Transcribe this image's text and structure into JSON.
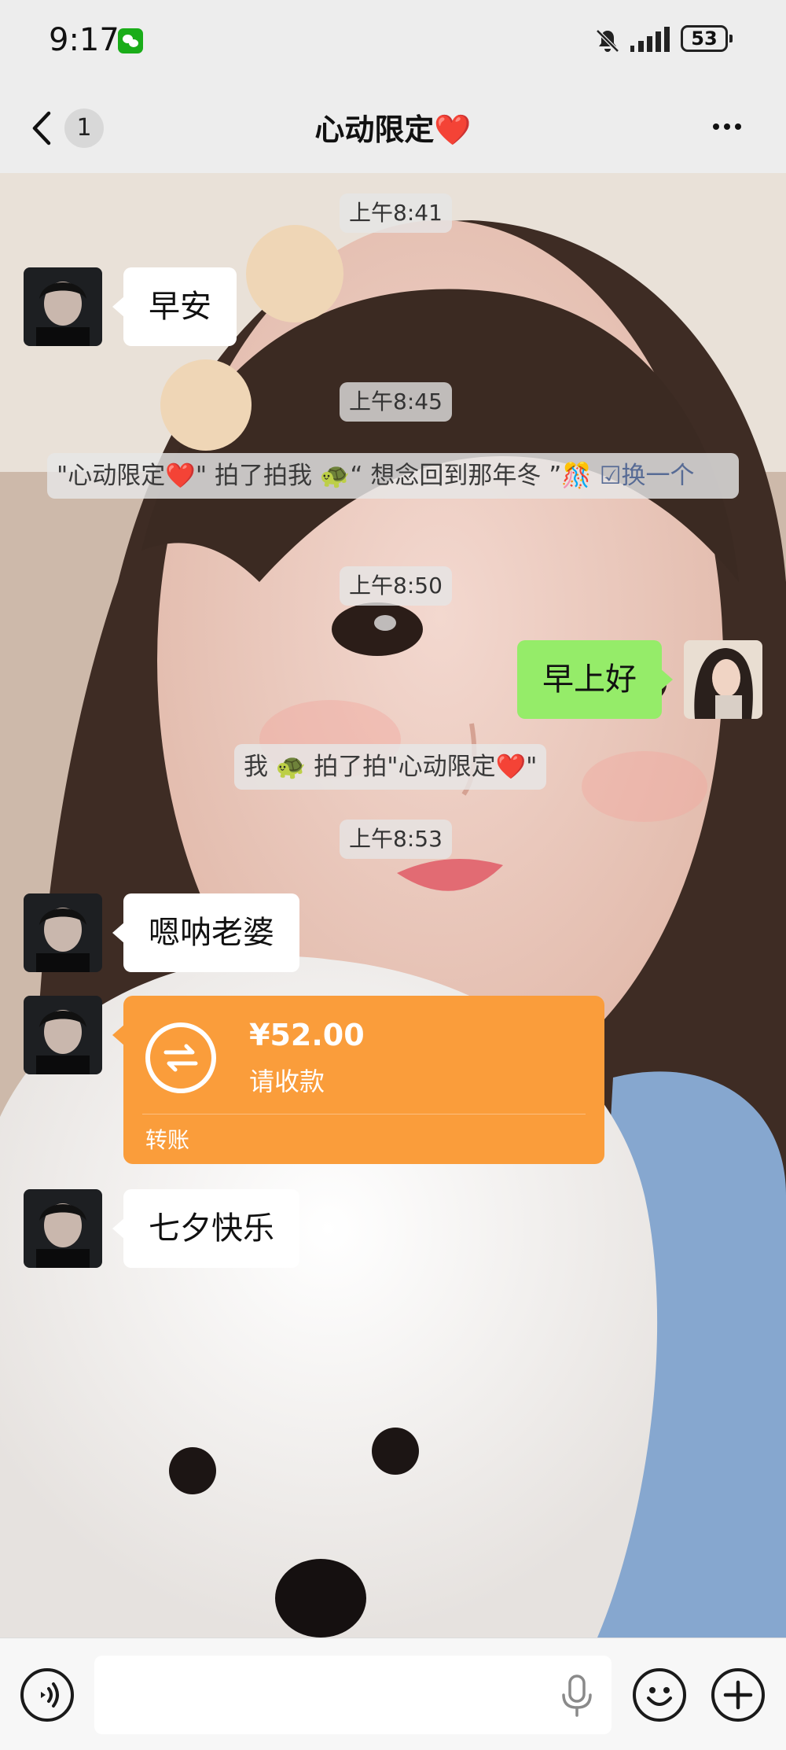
{
  "status_bar": {
    "time": "9:17",
    "battery": "53"
  },
  "nav": {
    "unread_count": "1",
    "title": "心动限定❤️"
  },
  "messages": {
    "t1": "上午8:41",
    "m1": "早安",
    "t2": "上午8:45",
    "pat1": {
      "text": "\"心动限定❤️\" 拍了拍我 🐢“ 想念回到那年冬 ”🎊 ",
      "link": "☑换一个"
    },
    "t3": "上午8:50",
    "m2": "早上好",
    "pat2": "我 🐢 拍了拍\"心动限定❤️\"",
    "t4": "上午8:53",
    "m3": "嗯呐老婆",
    "transfer": {
      "amount": "¥52.00",
      "status": "请收款",
      "label": "转账"
    },
    "m4": "七夕快乐"
  },
  "colors": {
    "background": "#ededed",
    "bubble_self": "#95ec69",
    "bubble_other": "#ffffff",
    "transfer_card": "#fa9d3b",
    "link": "#576b95",
    "wechat_green": "#1aad19"
  },
  "icons": {
    "status_app": "wechat-icon",
    "mute": "bell-off-icon",
    "signal": "signal-icon",
    "back": "chevron-left-icon",
    "more": "more-dots-icon",
    "transfer": "transfer-arrows-icon",
    "voice": "voice-mode-icon",
    "mic": "microphone-icon",
    "emoji": "emoji-icon",
    "plus": "plus-icon"
  }
}
